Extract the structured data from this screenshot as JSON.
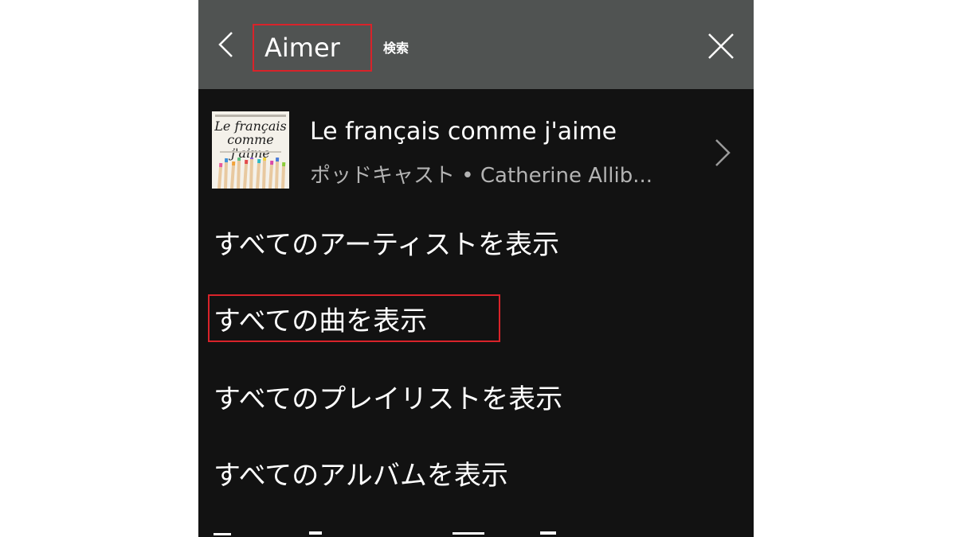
{
  "header": {
    "search_value": "Aimer",
    "search_label": "検索",
    "back_icon": "chevron-left-icon",
    "close_icon": "close-icon"
  },
  "podcast": {
    "title": "Le français comme j'aime",
    "subtitle": "ポッドキャスト • Catherine Allib...",
    "cover_title_line1": "Le français",
    "cover_title_line2": "comme j'aime",
    "chevron_icon": "chevron-right-icon"
  },
  "links": [
    "すべてのアーティストを表示",
    "すべての曲を表示",
    "すべてのプレイリストを表示",
    "すべてのアルバムを表示"
  ],
  "colors": {
    "background": "#121212",
    "header": "#505352",
    "highlight": "#d9232a",
    "text": "#ffffff",
    "subtext": "#b3b3b3"
  }
}
